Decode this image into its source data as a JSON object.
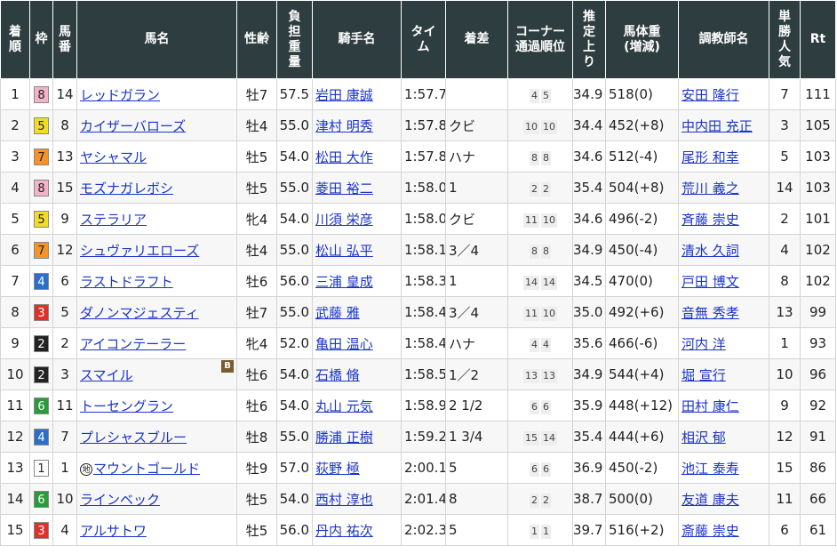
{
  "headers": [
    "着\n順",
    "枠",
    "馬\n番",
    "馬名",
    "性齢",
    "負\n担\n重\n量",
    "騎手名",
    "タイ\nム",
    "着差",
    "コーナー\n通過順位",
    "推\n定\n上\nり",
    "馬体重\n(増減)",
    "調教師名",
    "単\n勝\n人\n気",
    "Rt"
  ],
  "waku_colors": {
    "1": {
      "bg": "#ffffff",
      "fg": "#222222"
    },
    "2": {
      "bg": "#222222",
      "fg": "#ffffff"
    },
    "3": {
      "bg": "#e0302c",
      "fg": "#ffffff"
    },
    "4": {
      "bg": "#2b6fc7",
      "fg": "#ffffff"
    },
    "5": {
      "bg": "#f2dc2a",
      "fg": "#222222"
    },
    "6": {
      "bg": "#2a9a3a",
      "fg": "#ffffff"
    },
    "7": {
      "bg": "#f3932a",
      "fg": "#222222"
    },
    "8": {
      "bg": "#f4b3c8",
      "fg": "#222222"
    }
  },
  "rows": [
    {
      "rank": "1",
      "waku": "8",
      "num": "14",
      "horse": "レッドガラン",
      "sex_age": "牡7",
      "weight": "57.5",
      "jockey": "岩田 康誠",
      "time": "1:57.7",
      "margin": "",
      "corner": [
        "4",
        "5"
      ],
      "last3f": "34.9",
      "body_weight": "518(0)",
      "trainer": "安田 隆行",
      "pop": "7",
      "rt": "111"
    },
    {
      "rank": "2",
      "waku": "5",
      "num": "8",
      "horse": "カイザーバローズ",
      "sex_age": "牡4",
      "weight": "55.0",
      "jockey": "津村 明秀",
      "time": "1:57.8",
      "margin": "クビ",
      "corner": [
        "10",
        "10"
      ],
      "last3f": "34.4",
      "body_weight": "452(+8)",
      "trainer": "中内田 充正",
      "pop": "3",
      "rt": "105"
    },
    {
      "rank": "3",
      "waku": "7",
      "num": "13",
      "horse": "ヤシャマル",
      "sex_age": "牡5",
      "weight": "54.0",
      "jockey": "松田 大作",
      "time": "1:57.8",
      "margin": "ハナ",
      "corner": [
        "8",
        "8"
      ],
      "last3f": "34.6",
      "body_weight": "512(-4)",
      "trainer": "尾形 和幸",
      "pop": "5",
      "rt": "103"
    },
    {
      "rank": "4",
      "waku": "8",
      "num": "15",
      "horse": "モズナガレボシ",
      "sex_age": "牡5",
      "weight": "55.0",
      "jockey": "菱田 裕二",
      "time": "1:58.0",
      "margin": "1",
      "corner": [
        "2",
        "2"
      ],
      "last3f": "35.4",
      "body_weight": "504(+8)",
      "trainer": "荒川 義之",
      "pop": "14",
      "rt": "103"
    },
    {
      "rank": "5",
      "waku": "5",
      "num": "9",
      "horse": "ステラリア",
      "sex_age": "牝4",
      "weight": "54.0",
      "jockey": "川須 栄彦",
      "time": "1:58.0",
      "margin": "クビ",
      "corner": [
        "11",
        "10"
      ],
      "last3f": "34.6",
      "body_weight": "496(-2)",
      "trainer": "斉藤 崇史",
      "pop": "2",
      "rt": "101"
    },
    {
      "rank": "6",
      "waku": "7",
      "num": "12",
      "horse": "シュヴァリエローズ",
      "sex_age": "牡4",
      "weight": "55.0",
      "jockey": "松山 弘平",
      "time": "1:58.1",
      "margin": "3／4",
      "corner": [
        "8",
        "8"
      ],
      "last3f": "34.9",
      "body_weight": "450(-4)",
      "trainer": "清水 久詞",
      "pop": "4",
      "rt": "102"
    },
    {
      "rank": "7",
      "waku": "4",
      "num": "6",
      "horse": "ラストドラフト",
      "sex_age": "牡6",
      "weight": "56.0",
      "jockey": "三浦 皇成",
      "time": "1:58.3",
      "margin": "1",
      "corner": [
        "14",
        "14"
      ],
      "last3f": "34.5",
      "body_weight": "470(0)",
      "trainer": "戸田 博文",
      "pop": "8",
      "rt": "102"
    },
    {
      "rank": "8",
      "waku": "3",
      "num": "5",
      "horse": "ダノンマジェスティ",
      "sex_age": "牡7",
      "weight": "55.0",
      "jockey": "武藤 雅",
      "time": "1:58.4",
      "margin": "3／4",
      "corner": [
        "11",
        "10"
      ],
      "last3f": "35.0",
      "body_weight": "492(+6)",
      "trainer": "音無 秀孝",
      "pop": "13",
      "rt": "99"
    },
    {
      "rank": "9",
      "waku": "2",
      "num": "2",
      "horse": "アイコンテーラー",
      "sex_age": "牝4",
      "weight": "52.0",
      "jockey": "亀田 温心",
      "time": "1:58.4",
      "margin": "ハナ",
      "corner": [
        "4",
        "4"
      ],
      "last3f": "35.6",
      "body_weight": "466(-6)",
      "trainer": "河内 洋",
      "pop": "1",
      "rt": "93"
    },
    {
      "rank": "10",
      "waku": "2",
      "num": "3",
      "horse": "スマイル",
      "blinker": "B",
      "sex_age": "牡6",
      "weight": "54.0",
      "jockey": "石橋 脩",
      "time": "1:58.5",
      "margin": "1／2",
      "corner": [
        "13",
        "13"
      ],
      "last3f": "34.9",
      "body_weight": "544(+4)",
      "trainer": "堀 宣行",
      "pop": "10",
      "rt": "96"
    },
    {
      "rank": "11",
      "waku": "6",
      "num": "11",
      "horse": "トーセングラン",
      "sex_age": "牡6",
      "weight": "54.0",
      "jockey": "丸山 元気",
      "time": "1:58.9",
      "margin": "2 1/2",
      "corner": [
        "6",
        "6"
      ],
      "last3f": "35.9",
      "body_weight": "448(+12)",
      "trainer": "田村 康仁",
      "pop": "9",
      "rt": "92"
    },
    {
      "rank": "12",
      "waku": "4",
      "num": "7",
      "horse": "プレシャスブルー",
      "sex_age": "牡8",
      "weight": "55.0",
      "jockey": "勝浦 正樹",
      "time": "1:59.2",
      "margin": "1 3/4",
      "corner": [
        "15",
        "14"
      ],
      "last3f": "35.4",
      "body_weight": "444(+6)",
      "trainer": "相沢 郁",
      "pop": "12",
      "rt": "91"
    },
    {
      "rank": "13",
      "waku": "1",
      "num": "1",
      "horse": "マウントゴールド",
      "chihou": "地",
      "sex_age": "牡9",
      "weight": "57.0",
      "jockey": "荻野 極",
      "time": "2:00.1",
      "margin": "5",
      "corner": [
        "6",
        "6"
      ],
      "last3f": "36.9",
      "body_weight": "450(-2)",
      "trainer": "池江 泰寿",
      "pop": "15",
      "rt": "86"
    },
    {
      "rank": "14",
      "waku": "6",
      "num": "10",
      "horse": "ラインベック",
      "sex_age": "牡5",
      "weight": "54.0",
      "jockey": "西村 淳也",
      "time": "2:01.4",
      "margin": "8",
      "corner": [
        "2",
        "2"
      ],
      "last3f": "38.7",
      "body_weight": "500(0)",
      "trainer": "友道 康夫",
      "pop": "11",
      "rt": "66"
    },
    {
      "rank": "15",
      "waku": "3",
      "num": "4",
      "horse": "アルサトワ",
      "sex_age": "牡5",
      "weight": "56.0",
      "jockey": "丹内 祐次",
      "time": "2:02.3",
      "margin": "5",
      "corner": [
        "1",
        "1"
      ],
      "last3f": "39.7",
      "body_weight": "516(+2)",
      "trainer": "斎藤 崇史",
      "pop": "6",
      "rt": "61"
    }
  ]
}
